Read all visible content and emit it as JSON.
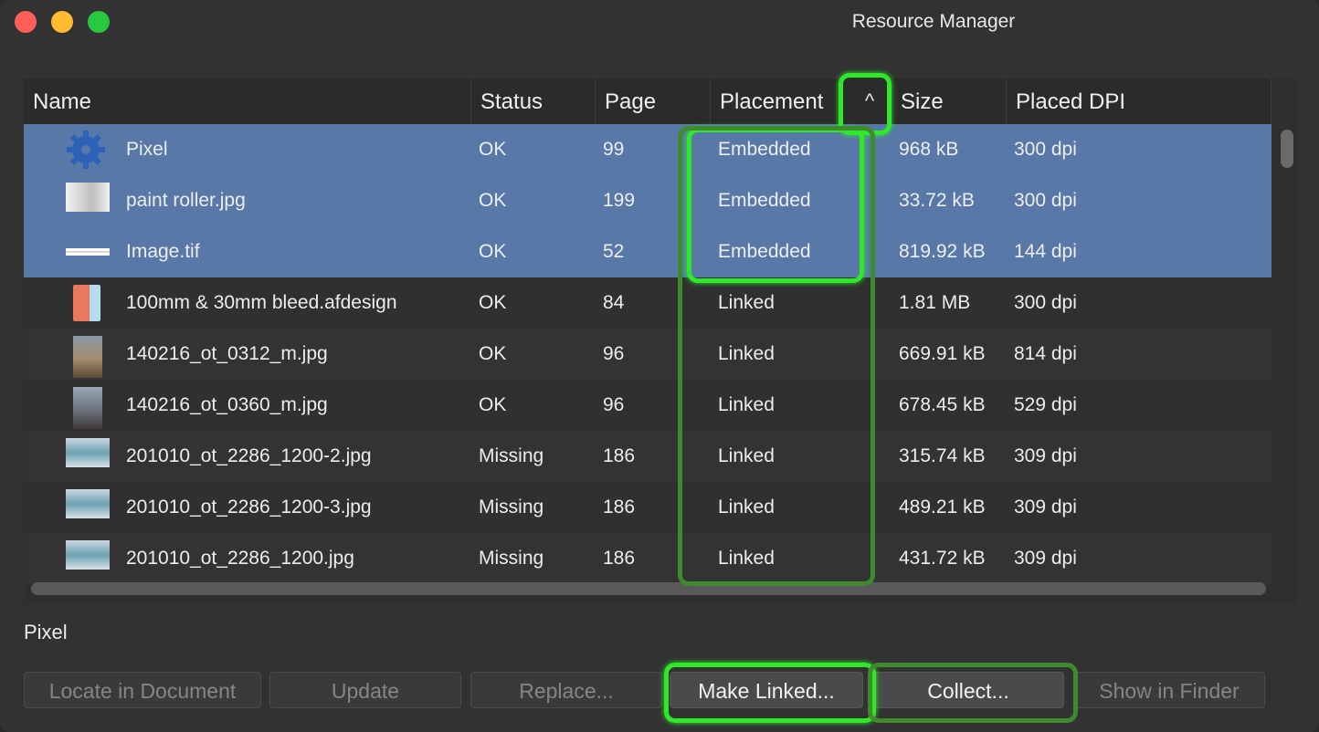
{
  "window": {
    "title": "Resource Manager"
  },
  "table": {
    "columns": [
      "Name",
      "Status",
      "Page",
      "Placement",
      "Size",
      "Placed DPI"
    ],
    "sort_indicator": "^",
    "rows": [
      {
        "name": "Pixel",
        "status": "OK",
        "page": "99",
        "placement": "Embedded",
        "size": "968 kB",
        "dpi": "300 dpi",
        "thumb": "gear-icon",
        "selected": true
      },
      {
        "name": "paint roller.jpg",
        "status": "OK",
        "page": "199",
        "placement": "Embedded",
        "size": "33.72 kB",
        "dpi": "300 dpi",
        "thumb": "image-thumbnail",
        "selected": true
      },
      {
        "name": "Image.tif",
        "status": "OK",
        "page": "52",
        "placement": "Embedded",
        "size": "819.92 kB",
        "dpi": "144 dpi",
        "thumb": "image-thumbnail",
        "selected": true
      },
      {
        "name": "100mm & 30mm bleed.afdesign",
        "status": "OK",
        "page": "84",
        "placement": "Linked",
        "size": "1.81 MB",
        "dpi": "300 dpi",
        "thumb": "design-file-thumbnail",
        "selected": false
      },
      {
        "name": "140216_ot_0312_m.jpg",
        "status": "OK",
        "page": "96",
        "placement": "Linked",
        "size": "669.91 kB",
        "dpi": "814 dpi",
        "thumb": "image-thumbnail",
        "selected": false
      },
      {
        "name": "140216_ot_0360_m.jpg",
        "status": "OK",
        "page": "96",
        "placement": "Linked",
        "size": "678.45 kB",
        "dpi": "529 dpi",
        "thumb": "image-thumbnail",
        "selected": false
      },
      {
        "name": "201010_ot_2286_1200-2.jpg",
        "status": "Missing",
        "page": "186",
        "placement": "Linked",
        "size": "315.74 kB",
        "dpi": "309 dpi",
        "thumb": "image-thumbnail",
        "selected": false
      },
      {
        "name": "201010_ot_2286_1200-3.jpg",
        "status": "Missing",
        "page": "186",
        "placement": "Linked",
        "size": "489.21 kB",
        "dpi": "309 dpi",
        "thumb": "image-thumbnail",
        "selected": false
      },
      {
        "name": "201010_ot_2286_1200.jpg",
        "status": "Missing",
        "page": "186",
        "placement": "Linked",
        "size": "431.72 kB",
        "dpi": "309 dpi",
        "thumb": "image-thumbnail",
        "selected": false
      }
    ]
  },
  "selection_label": "Pixel",
  "buttons": {
    "locate": "Locate in Document",
    "update": "Update",
    "replace": "Replace...",
    "make_linked": "Make Linked...",
    "collect": "Collect...",
    "show_in_finder": "Show in Finder"
  },
  "colors": {
    "selection": "#5879a8",
    "highlight": "#2fe82a"
  }
}
